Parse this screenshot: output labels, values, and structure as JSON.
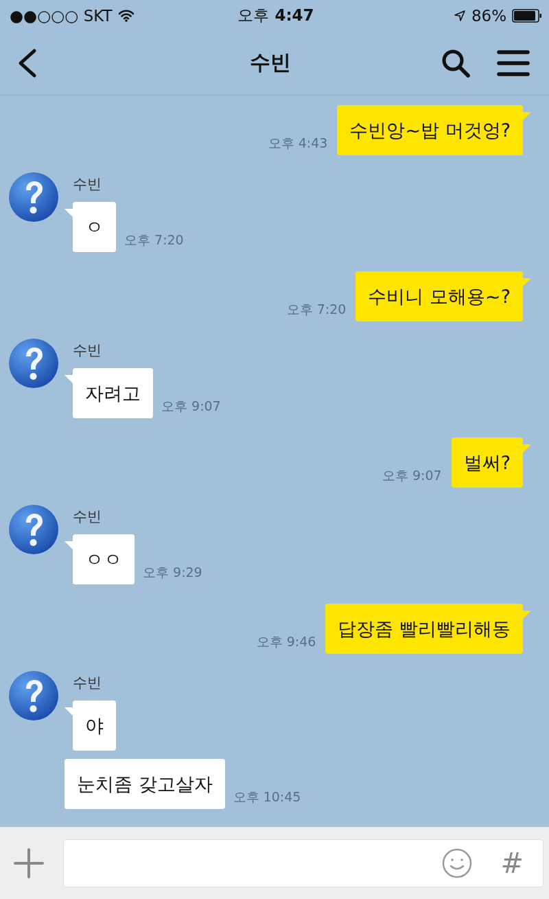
{
  "status_bar": {
    "carrier": "●●○○○ SKT",
    "time_prefix": "오후",
    "time": "4:47",
    "battery": "86%"
  },
  "header": {
    "title": "수빈"
  },
  "messages": [
    {
      "kind": "sent",
      "bubbles": [
        "수빈앙~밥 머것엉?"
      ],
      "time": "오후 4:43"
    },
    {
      "kind": "received",
      "sender": "수빈",
      "bubbles": [
        "ㅇ"
      ],
      "time": "오후 7:20"
    },
    {
      "kind": "sent",
      "bubbles": [
        "수비니 모해용~?"
      ],
      "time": "오후 7:20"
    },
    {
      "kind": "received",
      "sender": "수빈",
      "bubbles": [
        "자려고"
      ],
      "time": "오후 9:07"
    },
    {
      "kind": "sent",
      "bubbles": [
        "벌써?"
      ],
      "time": "오후 9:07"
    },
    {
      "kind": "received",
      "sender": "수빈",
      "bubbles": [
        "ㅇㅇ"
      ],
      "time": "오후 9:29"
    },
    {
      "kind": "sent",
      "bubbles": [
        "답장좀 빨리빨리해동"
      ],
      "time": "오후 9:46"
    },
    {
      "kind": "received",
      "sender": "수빈",
      "bubbles": [
        "야",
        "눈치좀 갖고살자"
      ],
      "time": "오후 10:45"
    }
  ],
  "input_bar": {
    "hash": "#"
  }
}
